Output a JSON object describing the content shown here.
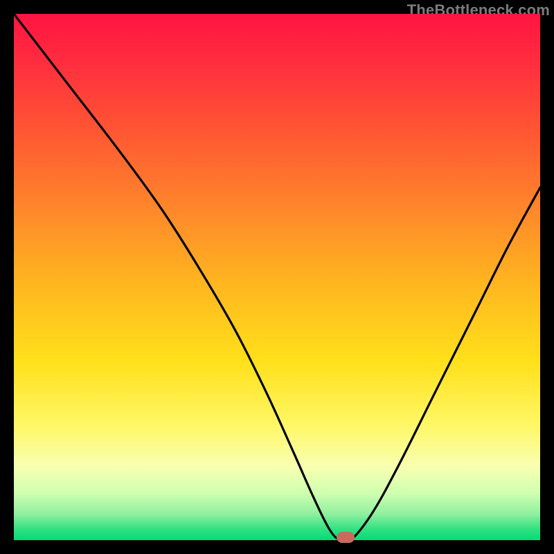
{
  "watermark": "TheBottleneck.com",
  "colors": {
    "frame": "#000000",
    "curve": "#000000",
    "marker": "#c96a5e",
    "gradient_top": "#ff1440",
    "gradient_bottom": "#00dd77"
  },
  "chart_data": {
    "type": "line",
    "title": "",
    "xlabel": "",
    "ylabel": "",
    "xlim": [
      0,
      100
    ],
    "ylim": [
      0,
      100
    ],
    "grid": false,
    "legend": false,
    "annotations": [
      "TheBottleneck.com"
    ],
    "series": [
      {
        "name": "bottleneck-curve",
        "x": [
          0,
          10,
          20,
          28,
          35,
          42,
          48,
          53,
          57,
          60,
          62,
          64,
          68,
          73,
          80,
          88,
          94,
          100
        ],
        "values": [
          100,
          87,
          74,
          63,
          52,
          40,
          28,
          17,
          8,
          2,
          0,
          0,
          5,
          14,
          28,
          44,
          56,
          67
        ]
      }
    ],
    "marker": {
      "x": 63,
      "y": 0
    }
  }
}
